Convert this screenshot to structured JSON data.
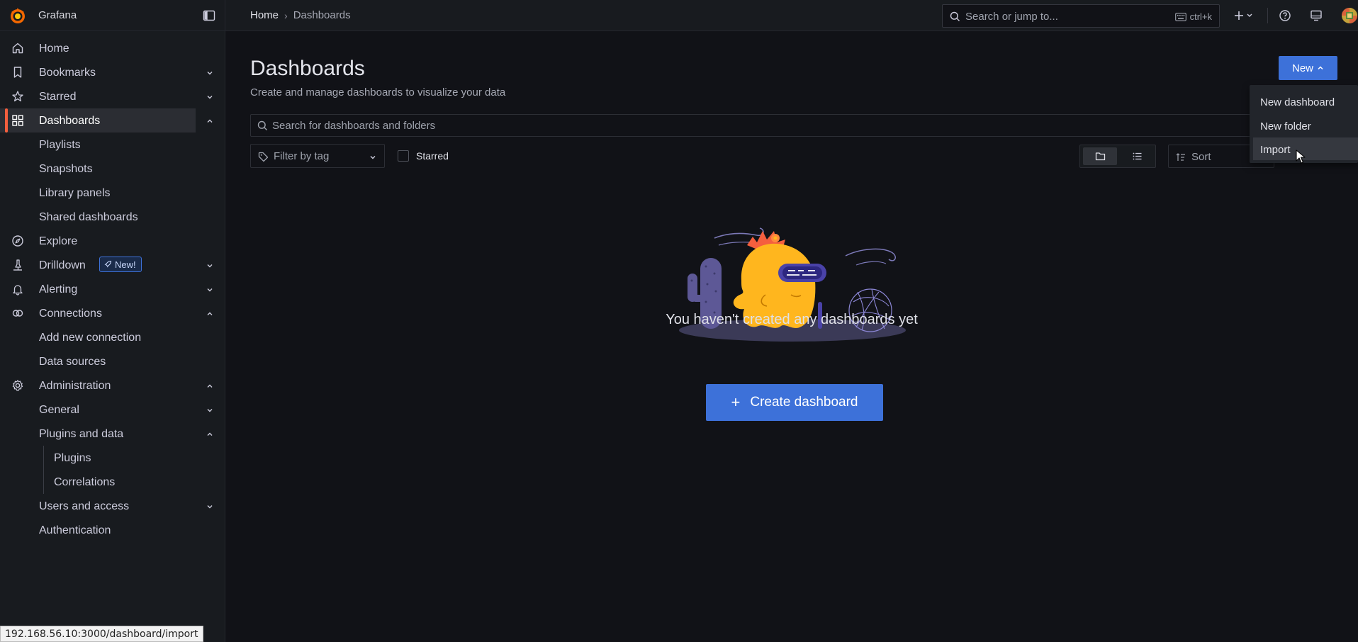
{
  "app": {
    "name": "Grafana"
  },
  "sidebar": {
    "items": [
      {
        "label": "Home"
      },
      {
        "label": "Bookmarks"
      },
      {
        "label": "Starred"
      },
      {
        "label": "Dashboards"
      },
      {
        "label": "Playlists"
      },
      {
        "label": "Snapshots"
      },
      {
        "label": "Library panels"
      },
      {
        "label": "Shared dashboards"
      },
      {
        "label": "Explore"
      },
      {
        "label": "Drilldown",
        "badge": "New!"
      },
      {
        "label": "Alerting"
      },
      {
        "label": "Connections"
      },
      {
        "label": "Add new connection"
      },
      {
        "label": "Data sources"
      },
      {
        "label": "Administration"
      },
      {
        "label": "General"
      },
      {
        "label": "Plugins and data"
      },
      {
        "label": "Plugins"
      },
      {
        "label": "Correlations"
      },
      {
        "label": "Users and access"
      },
      {
        "label": "Authentication"
      }
    ]
  },
  "topbar": {
    "breadcrumb": [
      "Home",
      "Dashboards"
    ],
    "breadcrumb_sep": "›",
    "search_placeholder": "Search or jump to...",
    "search_shortcut": "ctrl+k"
  },
  "main": {
    "title": "Dashboards",
    "subtitle": "Create and manage dashboards to visualize your data",
    "new_button": "New",
    "search_placeholder": "Search for dashboards and folders",
    "tag_filter_placeholder": "Filter by tag",
    "starred_label": "Starred",
    "sort_label": "Sort",
    "empty_message": "You haven't created any dashboards yet",
    "create_button": "Create dashboard",
    "create_button_plus": "+"
  },
  "new_menu": {
    "items": [
      "New dashboard",
      "New folder",
      "Import"
    ],
    "hovered": "Import"
  },
  "status_bar": {
    "url": "192.168.56.10:3000/dashboard/import"
  },
  "colors": {
    "accent": "#3d71d9",
    "active_indicator": "#f55f3e",
    "background": "#111217",
    "sidebar": "#181b1f",
    "mascot": "#ffb61e"
  }
}
